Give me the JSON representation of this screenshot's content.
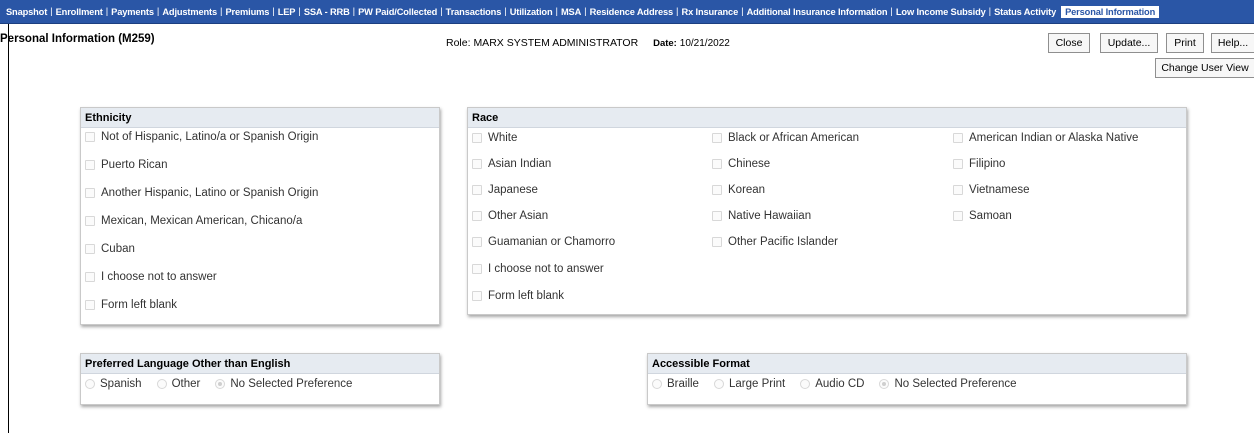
{
  "tabs": [
    {
      "label": "Snapshot"
    },
    {
      "label": "Enrollment"
    },
    {
      "label": "Payments"
    },
    {
      "label": "Adjustments"
    },
    {
      "label": "Premiums"
    },
    {
      "label": "LEP"
    },
    {
      "label": "SSA - RRB"
    },
    {
      "label": "PW Paid/Collected"
    },
    {
      "label": "Transactions"
    },
    {
      "label": "Utilization"
    },
    {
      "label": "MSA"
    },
    {
      "label": "Residence Address"
    },
    {
      "label": "Rx Insurance"
    },
    {
      "label": "Additional Insurance Information"
    },
    {
      "label": "Low Income Subsidy"
    },
    {
      "label": "Status Activity"
    },
    {
      "label": "Personal Information"
    }
  ],
  "header": {
    "title": "Personal Information (M259)",
    "role_label": "Role:",
    "role_value": "MARX SYSTEM ADMINISTRATOR",
    "date_label": "Date:",
    "date_value": "10/21/2022"
  },
  "buttons": {
    "close": "Close",
    "update": "Update...",
    "print": "Print",
    "help": "Help...",
    "change_user_view": "Change User View"
  },
  "ethnicity": {
    "title": "Ethnicity",
    "options": [
      "Not of Hispanic, Latino/a or Spanish Origin",
      "Puerto Rican",
      "Another Hispanic, Latino or Spanish Origin",
      "Mexican, Mexican American, Chicano/a",
      "Cuban",
      "I choose not to answer",
      "Form left blank"
    ]
  },
  "race": {
    "title": "Race",
    "col1": [
      "White",
      "Asian Indian",
      "Japanese",
      "Other Asian",
      "Guamanian or Chamorro",
      "I choose not to answer",
      "Form left blank"
    ],
    "col2": [
      "Black or African American",
      "Chinese",
      "Korean",
      "Native Hawaiian",
      "Other Pacific Islander"
    ],
    "col3": [
      "American Indian or Alaska Native",
      "Filipino",
      "Vietnamese",
      "Samoan"
    ]
  },
  "language": {
    "title": "Preferred Language Other than English",
    "options": [
      "Spanish",
      "Other",
      "No Selected Preference"
    ],
    "selected": "No Selected Preference"
  },
  "accessible": {
    "title": "Accessible Format",
    "options": [
      "Braille",
      "Large Print",
      "Audio CD",
      "No Selected Preference"
    ],
    "selected": "No Selected Preference"
  }
}
